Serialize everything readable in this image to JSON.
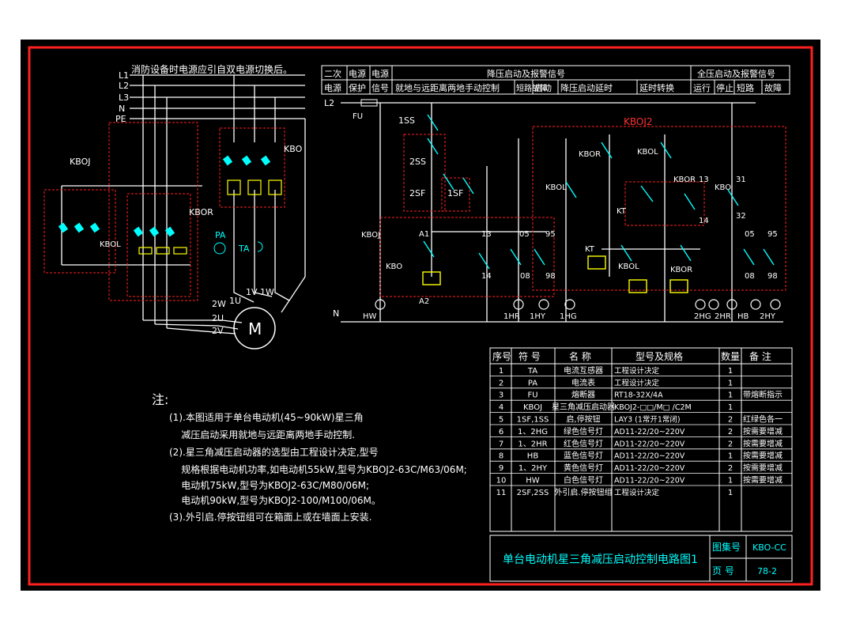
{
  "top_note": "消防设备时电源应引自双电源切换后。",
  "buses": [
    "L1",
    "L2",
    "L3",
    "N",
    "PE"
  ],
  "power_labels": {
    "kboj": "KBOJ",
    "kbo": "KBO",
    "kbor": "KBOR",
    "kbol": "KBOL",
    "pa": "PA",
    "ta": "TA",
    "motor": "M",
    "u1": "1U",
    "v1": "1V",
    "w1": "1W",
    "w2": "2W",
    "u2": "2U",
    "v2": "2V"
  },
  "control_header": {
    "cells": [
      "二次",
      "电源",
      "电源",
      "降压启动及报警信号",
      "全压启动及报警信号",
      "电源",
      "保护",
      "信号"
    ],
    "sub": [
      "就地与远距离两地手动控制",
      "短路故障",
      "启动",
      "降压启动延时",
      "延时转换",
      "运行",
      "停止",
      "短路",
      "故障"
    ]
  },
  "control_labels": {
    "l2": "L2",
    "fu": "FU",
    "kboj2": "KBOJ2",
    "n": "N",
    "ss1": "1SS",
    "ss2": "2SS",
    "sf2": "2SF",
    "sf1": "1SF",
    "kbor": "KBOR",
    "kbol": "KBOL",
    "kt": "KT",
    "kbo": "KBO",
    "kboj": "KBOJ",
    "a1": "A1",
    "a2": "A2",
    "t13": "13",
    "t14": "14",
    "t05": "05",
    "t95": "95",
    "t08": "08",
    "t98": "98",
    "t31": "31",
    "t32": "32",
    "hw": "HW",
    "hr1": "1HR",
    "hy1": "1HY",
    "hg1": "1HG",
    "hg2": "2HG",
    "hr2": "2HR",
    "hb": "HB",
    "hy2": "2HY"
  },
  "notes": {
    "title": "注:",
    "lines": [
      "(1).本图适用于单台电动机(45~90kW)星三角",
      "    减压启动采用就地与远距离两地手动控制.",
      "(2).星三角减压启动器的选型由工程设计决定,型号",
      "    规格根据电动机功率,如电动机55kW,型号为KBOJ2-63C/M63/06M;",
      "    电动机75kW,型号为KBOJ2-63C/M80/06M;",
      "    电动机90kW,型号为KBOJ2-100/M100/06M。",
      "(3).外引启.停按钮组可在箱面上或在墙面上安装."
    ]
  },
  "table": {
    "headers": [
      "序号",
      "符 号",
      "名 称",
      "型号及规格",
      "数量",
      "备 注"
    ],
    "rows": [
      [
        "1",
        "TA",
        "电流互感器",
        "工程设计决定",
        "1",
        ""
      ],
      [
        "2",
        "PA",
        "电流表",
        "工程设计决定",
        "1",
        ""
      ],
      [
        "3",
        "FU",
        "熔断器",
        "RT18-32X/4A",
        "1",
        "带熔断指示"
      ],
      [
        "4",
        "KBOJ",
        "星三角减压启动器",
        "KBOJ2-□□/M□ /C2M",
        "1",
        ""
      ],
      [
        "5",
        "1SF,1SS",
        "启,停按钮",
        "LAY3 (1常开1常闭)",
        "2",
        "红绿色各一"
      ],
      [
        "6",
        "1、2HG",
        "绿色信号灯",
        "AD11-22/20~220V",
        "2",
        "按需要增减"
      ],
      [
        "7",
        "1、2HR",
        "红色信号灯",
        "AD11-22/20~220V",
        "2",
        "按需要增减"
      ],
      [
        "8",
        "HB",
        "蓝色信号灯",
        "AD11-22/20~220V",
        "1",
        "按需要增减"
      ],
      [
        "9",
        "1、2HY",
        "黄色信号灯",
        "AD11-22/20~220V",
        "2",
        "按需要增减"
      ],
      [
        "10",
        "HW",
        "白色信号灯",
        "AD11-22/20~220V",
        "1",
        "按需要增减"
      ],
      [
        "11",
        "2SF,2SS",
        "外引启.停按钮组",
        "工程设计决定",
        "1",
        ""
      ]
    ]
  },
  "title_block": {
    "title": "单台电动机星三角减压启动控制电路图1",
    "atlas_label": "图集号",
    "atlas_value": "KBO-CC",
    "page_label": "页 号",
    "page_value": "78-2"
  }
}
